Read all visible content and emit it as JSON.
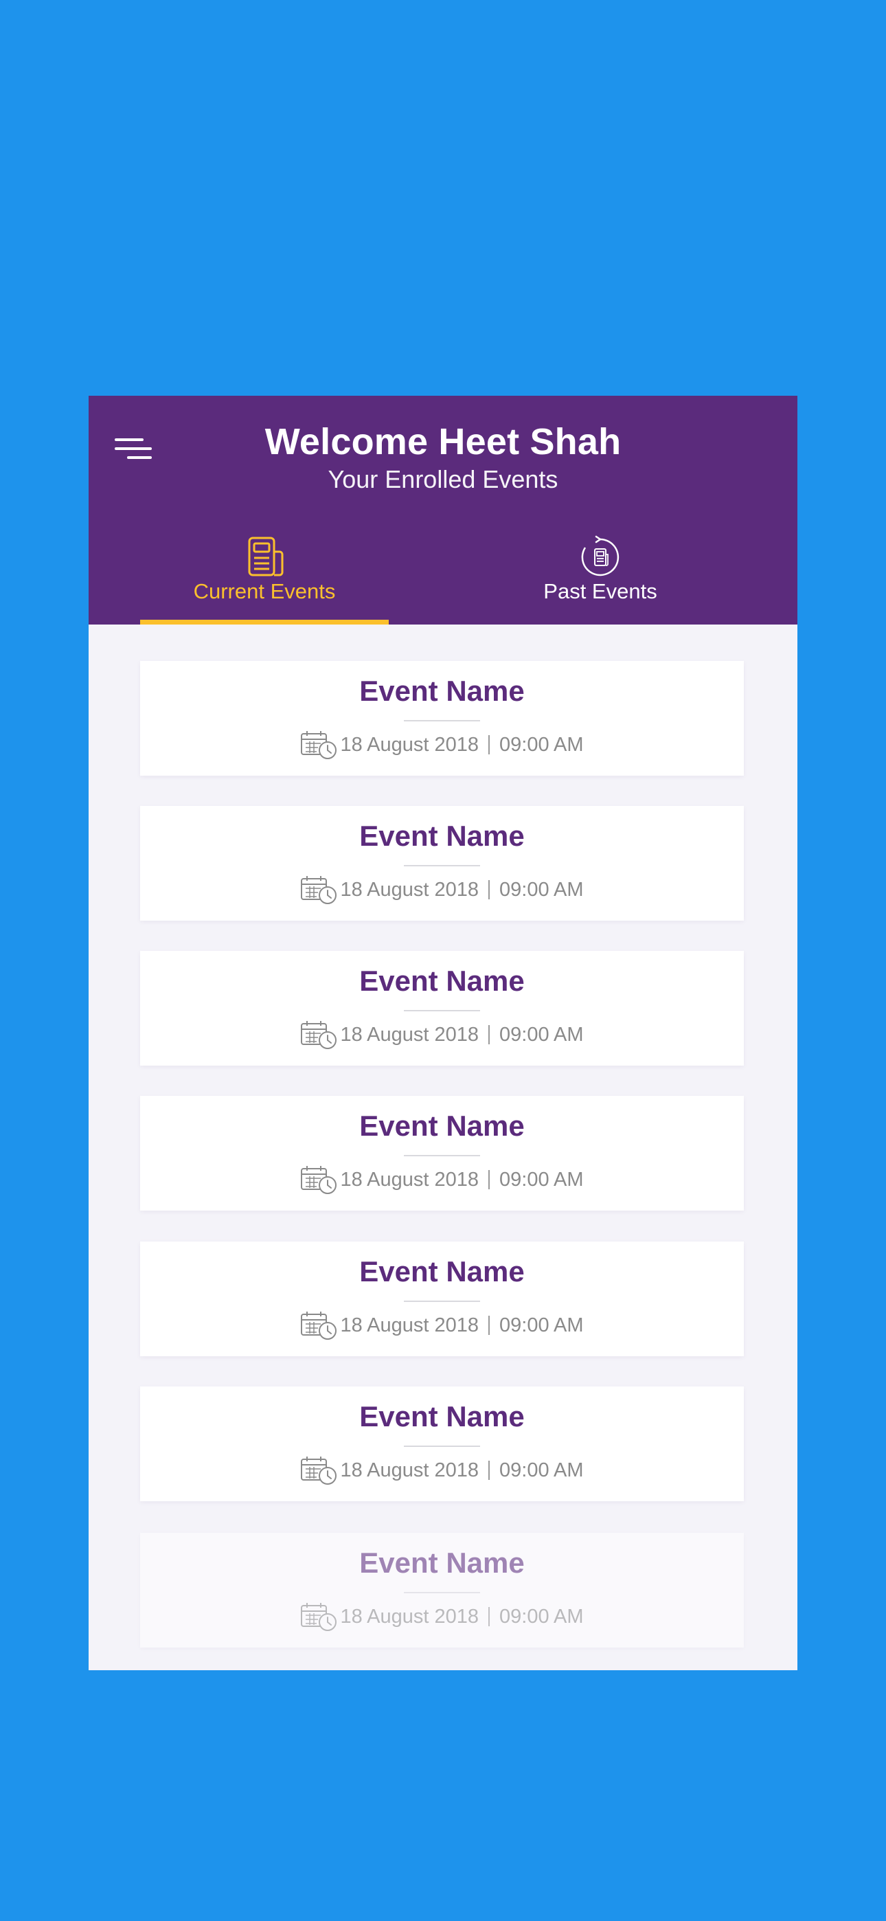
{
  "header": {
    "title": "Welcome Heet Shah",
    "subtitle": "Your Enrolled Events",
    "menu_icon": "menu-icon"
  },
  "tabs": [
    {
      "label": "Current Events",
      "icon": "newspaper-icon",
      "active": true
    },
    {
      "label": "Past Events",
      "icon": "history-icon",
      "active": false
    }
  ],
  "events": [
    {
      "name": "Event Name",
      "date": "18 August 2018",
      "time": "09:00 AM"
    },
    {
      "name": "Event Name",
      "date": "18 August 2018",
      "time": "09:00 AM"
    },
    {
      "name": "Event Name",
      "date": "18 August 2018",
      "time": "09:00 AM"
    },
    {
      "name": "Event Name",
      "date": "18 August 2018",
      "time": "09:00 AM"
    },
    {
      "name": "Event Name",
      "date": "18 August 2018",
      "time": "09:00 AM"
    },
    {
      "name": "Event Name",
      "date": "18 August 2018",
      "time": "09:00 AM"
    },
    {
      "name": "Event Name",
      "date": "18 August 2018",
      "time": "09:00 AM"
    }
  ],
  "colors": {
    "background": "#1e93ec",
    "header": "#5b2b7c",
    "accent": "#fbc02d",
    "list_background": "#f4f3f9",
    "event_title": "#5b2b7c",
    "meta_text": "#8a8a8a"
  }
}
